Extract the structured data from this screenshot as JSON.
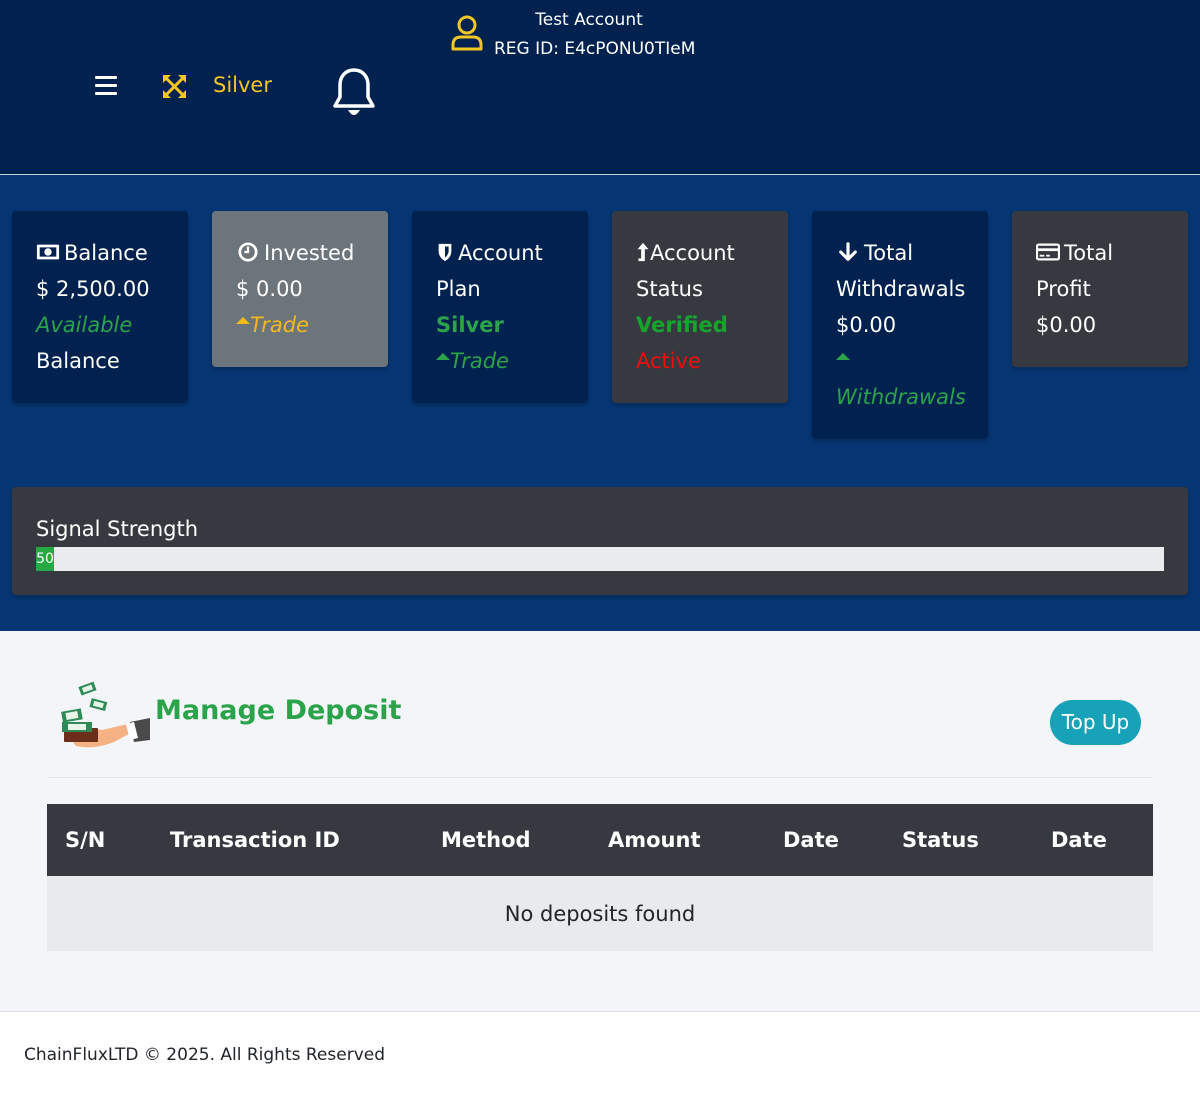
{
  "colors": {
    "header_bg": "#01214f",
    "band_bg": "#063673",
    "navy_card": "#01214f",
    "dark_card": "#363a40",
    "grey_card": "#6d757c",
    "accent_green": "#2ba34a",
    "accent_yellow": "#f3c623",
    "accent_red": "#ee0c0c",
    "topup_teal": "#17a2b8"
  },
  "header": {
    "user_name": "Test Account",
    "reg_id": "REG ID: E4cPONU0TIeM",
    "plan_label": "Silver",
    "icons": [
      "user-icon",
      "menu-icon",
      "expand-icon",
      "bell-icon"
    ]
  },
  "cards": {
    "balance": {
      "title": "Balance",
      "value": "$ 2,500.00",
      "sub": "Available",
      "sub2": "Balance",
      "icon": "money-bill-icon"
    },
    "invested": {
      "title": "Invested",
      "value": "$ 0.00",
      "sub": "Trade",
      "icon": "clock-icon"
    },
    "plan": {
      "title": "Account",
      "title2": "Plan",
      "value": "Silver",
      "sub": "Trade",
      "icon": "shield-icon"
    },
    "status": {
      "title": "Account",
      "title2": "Status",
      "value": "Verified",
      "sub": "Active",
      "icon": "level-up-icon"
    },
    "withdrawals": {
      "title": "Total",
      "title2": "Withdrawals",
      "value": "$0.00",
      "sub": "Withdrawals",
      "icon": "arrow-down-icon"
    },
    "profit": {
      "title": "Total",
      "title2": "Profit",
      "value": "$0.00",
      "icon": "credit-card-icon"
    }
  },
  "signal": {
    "title": "Signal Strength",
    "value_label": "50",
    "percent": 1.6
  },
  "deposit": {
    "title": "Manage Deposit",
    "topup_label": "Top Up",
    "columns": [
      "S/N",
      "Transaction ID",
      "Method",
      "Amount",
      "Date",
      "Status",
      "Date"
    ],
    "empty_message": "No deposits found"
  },
  "footer": {
    "text": "ChainFluxLTD © 2025. All Rights Reserved"
  }
}
